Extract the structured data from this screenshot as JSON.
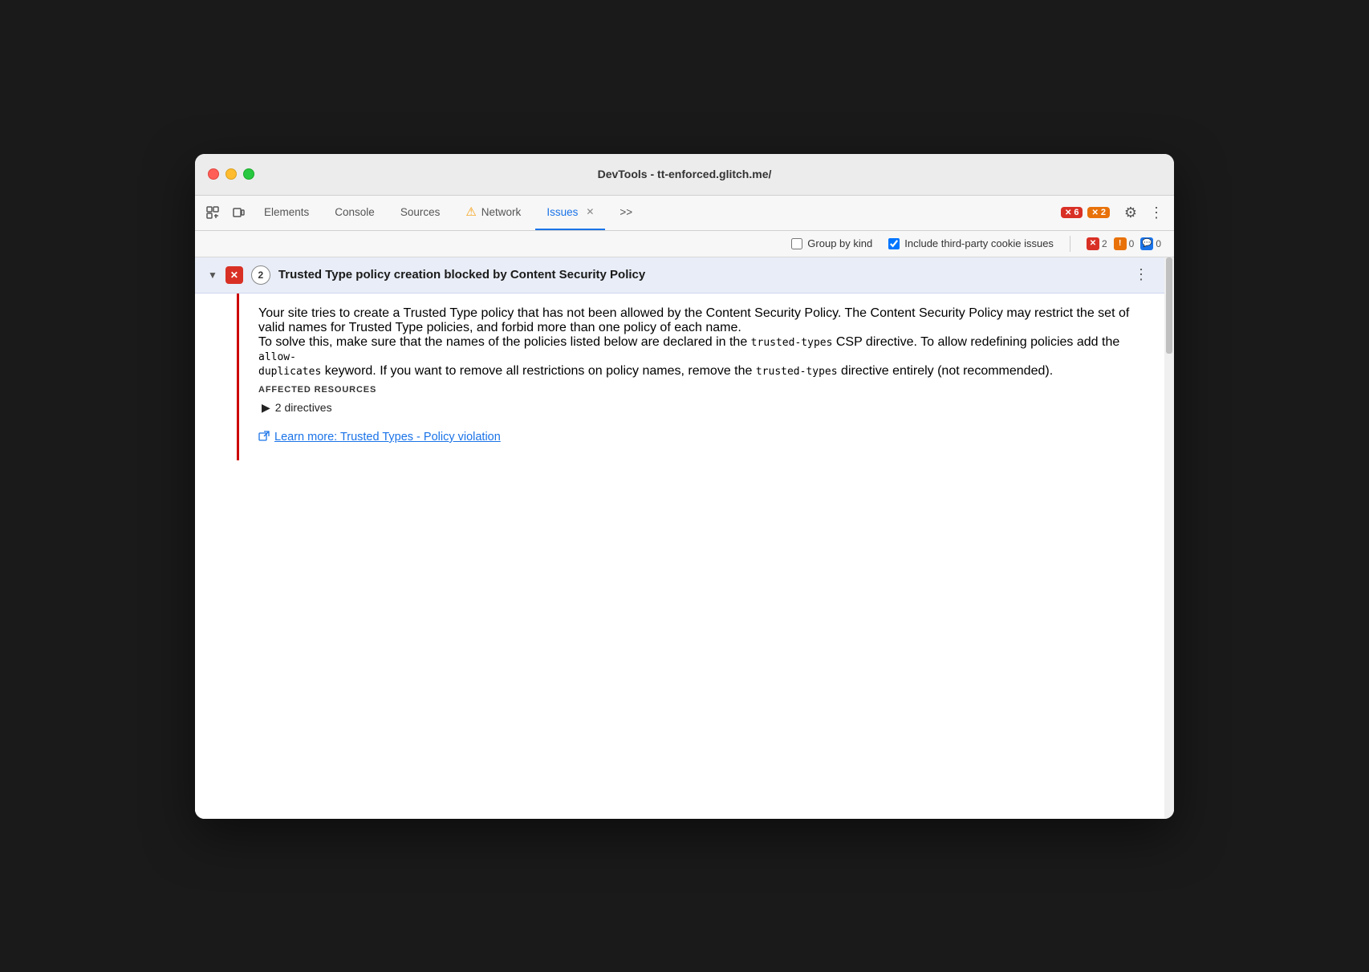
{
  "window": {
    "title": "DevTools - tt-enforced.glitch.me/"
  },
  "toolbar": {
    "elements_label": "Elements",
    "console_label": "Console",
    "sources_label": "Sources",
    "network_label": "Network",
    "issues_label": "Issues",
    "more_tabs_label": ">>",
    "error_count": "6",
    "warning_count": "2"
  },
  "options_bar": {
    "group_by_kind_label": "Group by kind",
    "group_by_kind_checked": false,
    "include_third_party_label": "Include third-party cookie issues",
    "include_third_party_checked": true,
    "red_badge_count": "2",
    "orange_badge_count": "0",
    "blue_badge_count": "0"
  },
  "issue": {
    "title": "Trusted Type policy creation blocked by Content Security Policy",
    "count": "2",
    "description_p1": "Your site tries to create a Trusted Type policy that has not been allowed by the Content Security Policy. The Content Security Policy may restrict the set of valid names for Trusted Type policies, and forbid more than one policy of each name.",
    "description_p2_before": "To solve this, make sure that the names of the policies listed below are declared in the ",
    "code1": "trusted-types",
    "description_p2_mid1": " CSP directive. To allow redefining policies add the ",
    "code2": "allow-\nduplicates",
    "description_p2_mid2": " keyword. If you want to remove all restrictions on policy names, remove the ",
    "code3": "trusted-types",
    "description_p2_end": " directive entirely (not recommended).",
    "affected_label": "AFFECTED RESOURCES",
    "directives_count": "2 directives",
    "learn_more_label": "Learn more: Trusted Types - Policy violation"
  }
}
